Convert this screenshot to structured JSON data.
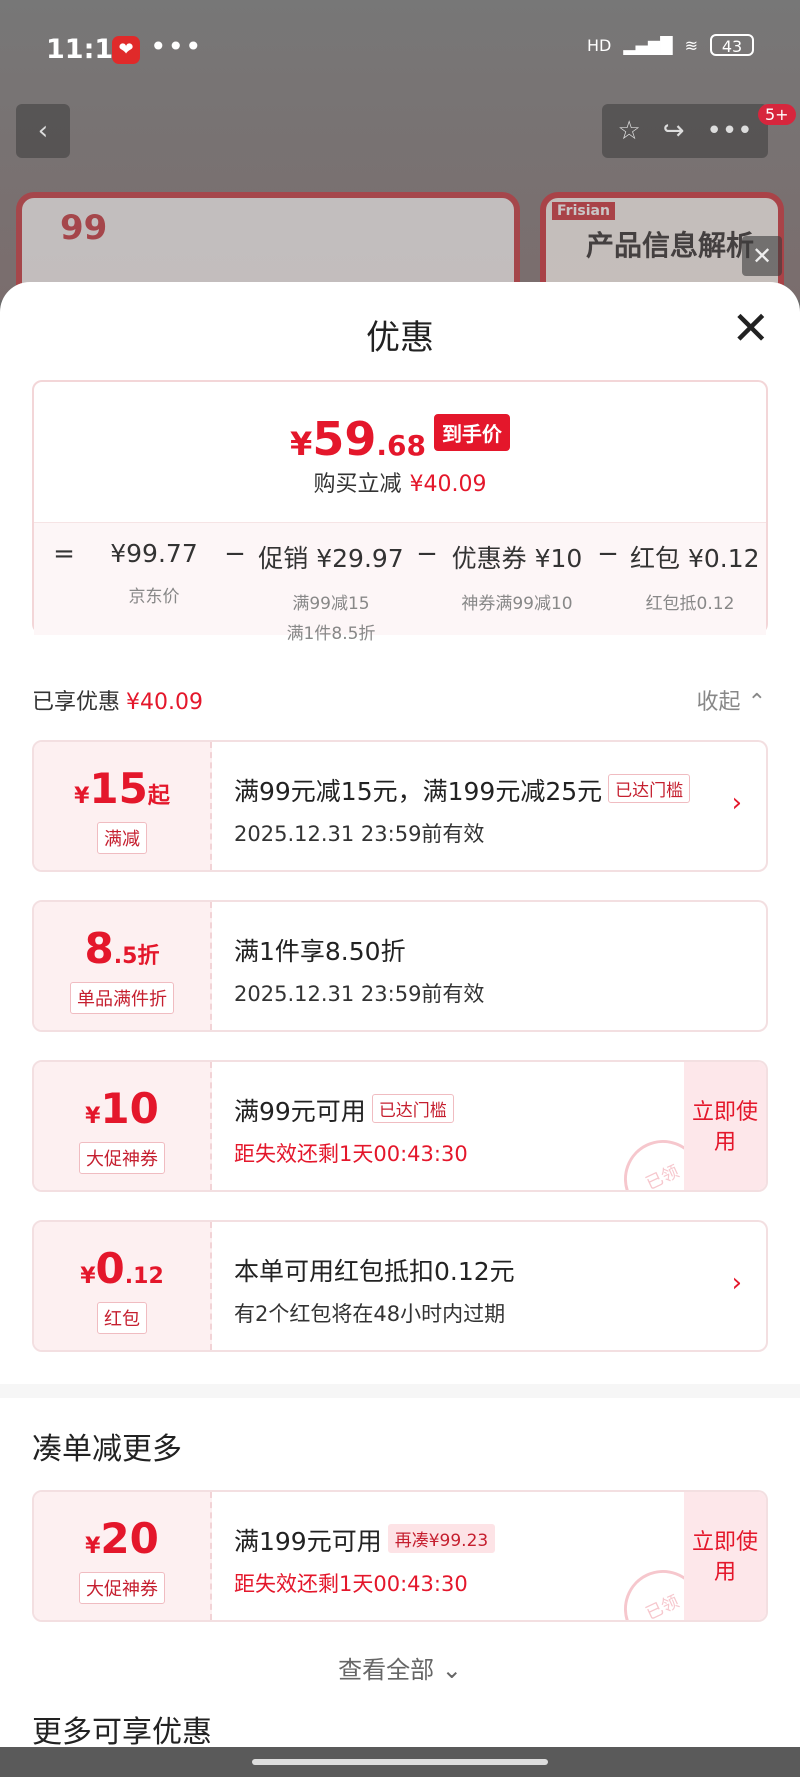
{
  "status": {
    "time": "11:17",
    "hd": "HD",
    "battery": "43",
    "notifications": "5+"
  },
  "background": {
    "card2_brand": "Frisian",
    "card2_title": "产品信息解析",
    "card1_logo": "99"
  },
  "sheet": {
    "title": "优惠"
  },
  "summary": {
    "yen": "¥",
    "price_int": "59",
    "price_dec": ".68",
    "price_tag": "到手价",
    "saved_label": "购买立减",
    "saved_value": "¥40.09",
    "formula": [
      {
        "op": "=",
        "value": "¥99.77",
        "subs": [
          "京东价"
        ]
      },
      {
        "op": "−",
        "value": "促销 ¥29.97",
        "subs": [
          "满99减15",
          "满1件8.5折"
        ]
      },
      {
        "op": "−",
        "value": "优惠券 ¥10",
        "subs": [
          "神券满99减10"
        ]
      },
      {
        "op": "−",
        "value": "红包 ¥0.12",
        "subs": [
          "红包抵0.12"
        ]
      }
    ]
  },
  "enjoyed": {
    "label": "已享优惠",
    "value": "¥40.09",
    "collapse": "收起"
  },
  "coupons": [
    {
      "amt_prefix": "¥",
      "amt_big": "15",
      "amt_suffix": "起",
      "label": "满减",
      "line1": "满99元减15元，满199元减25元",
      "pill": "已达门槛",
      "line2": "2025.12.31 23:59前有效"
    },
    {
      "amt_prefix": "",
      "amt_big": "8",
      "amt_suffix": ".5折",
      "label": "单品满件折",
      "line1": "满1件享8.50折",
      "line2": "2025.12.31 23:59前有效"
    },
    {
      "amt_prefix": "¥",
      "amt_big": "10",
      "amt_suffix": "",
      "label": "大促神券",
      "line1": "满99元可用",
      "pill": "已达门槛",
      "line2": "距失效还剩1天00:43:30",
      "use": "立即使用",
      "stamp": "已领"
    },
    {
      "amt_prefix": "¥",
      "amt_big": "0",
      "amt_suffix": ".12",
      "label": "红包",
      "line1": "本单可用红包抵扣0.12元",
      "line2": "有2个红包将在48小时内过期"
    }
  ],
  "more_section": {
    "title": "凑单减更多",
    "coupon": {
      "amt_prefix": "¥",
      "amt_big": "20",
      "label": "大促神券",
      "line1": "满199元可用",
      "pill": "再凑¥99.23",
      "line2": "距失效还剩1天00:43:30",
      "use": "立即使用",
      "stamp": "已领"
    },
    "view_all": "查看全部"
  },
  "more_available": {
    "title": "更多可享优惠"
  },
  "colors": {
    "accent": "#e4172b",
    "light_pink": "#fdf0f1"
  }
}
